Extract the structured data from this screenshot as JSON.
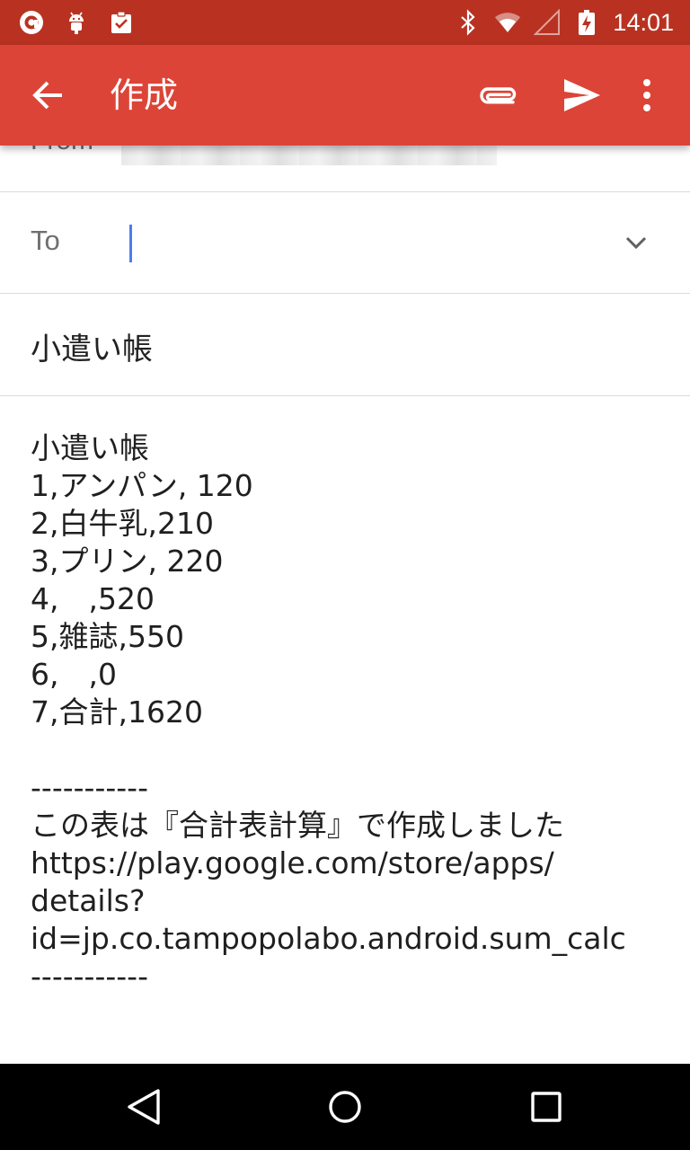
{
  "status_bar": {
    "time": "14:01",
    "left_icons": [
      "notification-app-icon",
      "android-debug-icon",
      "clipboard-check-icon"
    ],
    "right_icons": [
      "bluetooth-icon",
      "wifi-icon",
      "cell-signal-icon",
      "battery-charging-icon"
    ]
  },
  "app_bar": {
    "title": "作成",
    "actions": [
      "attach-icon",
      "send-icon",
      "more-vert-icon"
    ]
  },
  "compose": {
    "from_label": "From",
    "to_label": "To",
    "to_value": "",
    "subject": "小遣い帳",
    "body_lines": [
      "小遣い帳",
      "1,アンパン, 120",
      "2,白牛乳,210",
      "3,プリン, 220",
      "4,　,520",
      "5,雑誌,550",
      "6,　,0",
      "7,合計,1620",
      "",
      "-----------",
      "この表は『合計表計算』で作成しました",
      "https://play.google.com/store/apps/",
      "details?",
      "id=jp.co.tampopolabo.android.sum_calc",
      "-----------"
    ]
  },
  "colors": {
    "status_bar": "#b93221",
    "app_bar": "#dc4437",
    "cursor": "#4a7cf0"
  },
  "nav_bar": {
    "buttons": [
      "back-triangle-icon",
      "home-circle-icon",
      "recents-square-icon"
    ]
  }
}
